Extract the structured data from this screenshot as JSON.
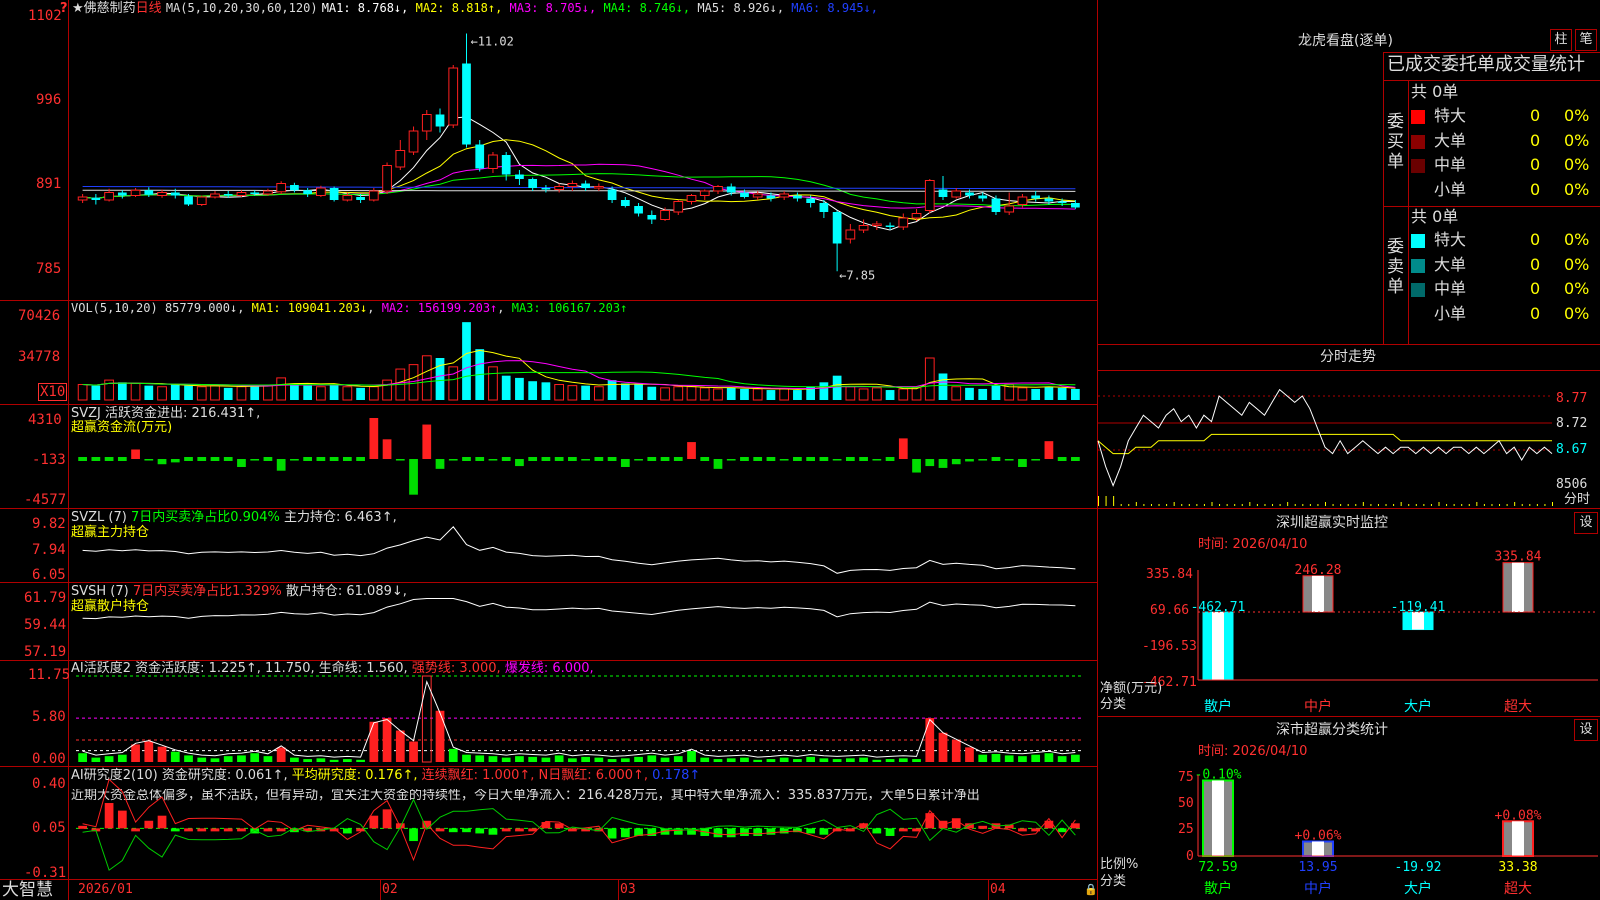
{
  "header": {
    "flag": "?",
    "star": "★",
    "stock_name": "佛慈制药",
    "period": "日线",
    "ma_params": "MA(5,10,20,30,60,120)",
    "ma_items": [
      {
        "label": "MA1: 8.768↓",
        "color": "#ffffff"
      },
      {
        "label": "MA2: 8.818↑",
        "color": "#ffff00"
      },
      {
        "label": "MA3: 8.705↓",
        "color": "#ff00ff"
      },
      {
        "label": "MA4: 8.746↓",
        "color": "#00ff00"
      },
      {
        "label": "MA5: 8.926↓",
        "color": "#dddddd"
      },
      {
        "label": "MA6: 8.945↓",
        "color": "#2040ff"
      }
    ]
  },
  "price_axis": [
    "1102",
    "996",
    "891",
    "785"
  ],
  "price_marks": {
    "high": "11.02",
    "low": "7.85"
  },
  "vol_header": {
    "params": "VOL(5,10,20)",
    "value": "85779.000↓",
    "ma1": "MA1: 109041.203↓",
    "ma2": "MA2: 156199.203↑",
    "ma3": "MA3: 106167.203↑"
  },
  "vol_axis": [
    "70426",
    "34778"
  ],
  "vol_unit": "X10",
  "svzj": {
    "title": "SVZJ  活跃资金进出: 216.431↑,",
    "sub": "超赢资金流(万元)",
    "axis": [
      "4310",
      "-133",
      "-4577"
    ]
  },
  "svzl": {
    "title": "SVZL (7)",
    "ratio": "7日内买卖净占比0.904%",
    "hold": "主力持仓: 6.463↑,",
    "sub": "超赢主力持仓",
    "axis": [
      "9.82",
      "7.94",
      "6.05"
    ]
  },
  "svsh": {
    "title": "SVSH (7)",
    "ratio": "7日内买卖净占比1.329%",
    "hold": "散户持仓: 61.089↓,",
    "sub": "超赢散户持仓",
    "axis": [
      "61.79",
      "59.44",
      "57.19"
    ]
  },
  "ai_active": {
    "title": "AI活跃度2",
    "t1": "资金活跃度: 1.225↑, 11.750,",
    "t2": "生命线: 1.560,",
    "t3": "强势线: 3.000,",
    "t4": "爆发线: 6.000,",
    "axis": [
      "11.75",
      "5.80",
      "0.00"
    ]
  },
  "ai_research": {
    "title": "AI研究度2(10)",
    "t1": "资金研究度: 0.061↑,",
    "t2": "平均研究度: 0.176↑,",
    "t3": "连续飘红: 1.000↑,",
    "t4": "N日飘红: 6.000↑,",
    "t5": "0.178↑",
    "comment": "近期大资金总体偏多，虽不活跃，但有异动，宜关注大资金的持续性，今日大单净流入：216.428万元，其中特大单净流入：335.837万元，大单5日累计净出",
    "axis": [
      "0.40",
      "0.05",
      "-0.31"
    ]
  },
  "date_axis": [
    "2026/01",
    "02",
    "03",
    "04"
  ],
  "brand": "大智慧",
  "right": {
    "lhkp_title": "龙虎看盘(逐单)",
    "btn_zhu": "柱",
    "btn_bi": "笔",
    "stats_title": "已成交委托单成交量统计",
    "buy_label": "委买单",
    "sell_label": "委卖单",
    "buy_total": "共 0单",
    "sell_total": "共 0单",
    "buy_rows": [
      {
        "name": "特大",
        "count": "0",
        "pct": "0%",
        "color": "#ff0000"
      },
      {
        "name": "大单",
        "count": "0",
        "pct": "0%",
        "color": "#8b0000"
      },
      {
        "name": "中单",
        "count": "0",
        "pct": "0%",
        "color": "#6a0000"
      },
      {
        "name": "小单",
        "count": "0",
        "pct": "0%",
        "color": "#000000"
      }
    ],
    "sell_rows": [
      {
        "name": "特大",
        "count": "0",
        "pct": "0%",
        "color": "#00ffff"
      },
      {
        "name": "大单",
        "count": "0",
        "pct": "0%",
        "color": "#008b8b"
      },
      {
        "name": "中单",
        "count": "0",
        "pct": "0%",
        "color": "#006a6a"
      },
      {
        "name": "小单",
        "count": "0",
        "pct": "0%",
        "color": "#000000"
      }
    ],
    "fs_title": "分时走势",
    "fs_axis": [
      "8.77",
      "8.72",
      "8.67",
      "8506",
      "分时"
    ],
    "monitor_title": "深圳超赢实时监控",
    "monitor_date": "时间: 2026/04/10",
    "monitor_btn": "设",
    "monitor_axis": [
      "335.84",
      "69.66",
      "-196.53",
      "-462.71"
    ],
    "monitor_ylabel": "净额(万元)",
    "monitor_xlabel": "分类",
    "monitor_bars": [
      {
        "cat": "散户",
        "value": -462.71,
        "label": "-462.71",
        "label_color": "#00ffff",
        "cat_color": "#00ffff"
      },
      {
        "cat": "中户",
        "value": 246.28,
        "label": "246.28",
        "label_color": "#ff3030",
        "cat_color": "#ff3030"
      },
      {
        "cat": "大户",
        "value": -119.41,
        "label": "-119.41",
        "label_color": "#00ffff",
        "cat_color": "#00ffff"
      },
      {
        "cat": "超大",
        "value": 335.84,
        "label": "335.84",
        "label_color": "#ff3030",
        "cat_color": "#ff3030"
      }
    ],
    "class_title": "深市超赢分类统计",
    "class_date": "时间: 2026/04/10",
    "class_btn": "设",
    "class_axis": [
      "75",
      "50",
      "25",
      "0"
    ],
    "class_ylabel": "比例%",
    "class_xlabel": "分类",
    "class_bars": [
      {
        "cat": "散户",
        "value": 72.59,
        "value_label": "72.59",
        "chg": "-0.10%",
        "chg_color": "#00ff00",
        "val_color": "#00ff00",
        "cat_color": "#00ff00",
        "bar": "#00ff00"
      },
      {
        "cat": "中户",
        "value": 13.95,
        "value_label": "13.95",
        "chg": "+0.06%",
        "chg_color": "#ff3030",
        "val_color": "#2040ff",
        "cat_color": "#2040ff",
        "bar": "#2040ff"
      },
      {
        "cat": "大户",
        "value": 0,
        "value_label": "-19.92",
        "chg": "",
        "chg_color": "#00ffff",
        "val_color": "#00ffff",
        "cat_color": "#00ffff",
        "bar": "#00ffff"
      },
      {
        "cat": "超大",
        "value": 33.38,
        "value_label": "33.38",
        "chg": "+0.08%",
        "chg_color": "#ff3030",
        "val_color": "#ffff00",
        "cat_color": "#ff3030",
        "bar": "#ff2020"
      }
    ]
  },
  "chart_data": {
    "type": "candlestick",
    "title": "佛慈制药 日线",
    "ylim": [
      7.6,
      11.2
    ],
    "candles": [
      [
        8.8,
        8.84,
        8.76,
        8.88
      ],
      [
        8.83,
        8.8,
        8.74,
        8.88
      ],
      [
        8.8,
        8.9,
        8.78,
        8.95
      ],
      [
        8.9,
        8.86,
        8.82,
        8.93
      ],
      [
        8.86,
        8.93,
        8.84,
        8.96
      ],
      [
        8.93,
        8.87,
        8.84,
        8.97
      ],
      [
        8.86,
        8.9,
        8.83,
        8.94
      ],
      [
        8.9,
        8.86,
        8.82,
        8.95
      ],
      [
        8.85,
        8.74,
        8.72,
        8.88
      ],
      [
        8.74,
        8.84,
        8.72,
        8.86
      ],
      [
        8.84,
        8.88,
        8.82,
        8.92
      ],
      [
        8.88,
        8.86,
        8.83,
        8.92
      ],
      [
        8.86,
        8.9,
        8.84,
        8.93
      ],
      [
        8.9,
        8.88,
        8.86,
        8.93
      ],
      [
        8.88,
        8.92,
        8.86,
        8.95
      ],
      [
        8.91,
        9.02,
        8.88,
        9.05
      ],
      [
        9.0,
        8.93,
        8.9,
        9.03
      ],
      [
        8.93,
        8.88,
        8.84,
        8.96
      ],
      [
        8.86,
        8.96,
        8.84,
        8.99
      ],
      [
        8.96,
        8.8,
        8.78,
        8.98
      ],
      [
        8.8,
        8.86,
        8.78,
        8.9
      ],
      [
        8.84,
        8.8,
        8.76,
        8.88
      ],
      [
        8.8,
        8.92,
        8.78,
        8.96
      ],
      [
        8.92,
        9.26,
        8.88,
        9.3
      ],
      [
        9.24,
        9.46,
        9.2,
        9.6
      ],
      [
        9.44,
        9.72,
        9.4,
        9.78
      ],
      [
        9.72,
        9.94,
        9.6,
        10.0
      ],
      [
        9.94,
        9.78,
        9.7,
        10.02
      ],
      [
        9.8,
        10.56,
        9.76,
        10.6
      ],
      [
        10.62,
        9.54,
        9.5,
        11.02
      ],
      [
        9.54,
        9.22,
        9.18,
        9.6
      ],
      [
        9.22,
        9.4,
        9.16,
        9.44
      ],
      [
        9.4,
        9.14,
        9.06,
        9.44
      ],
      [
        9.14,
        9.08,
        9.0,
        9.2
      ],
      [
        9.08,
        8.96,
        8.92,
        9.1
      ],
      [
        8.96,
        8.94,
        8.9,
        9.0
      ],
      [
        8.94,
        8.98,
        8.9,
        9.02
      ],
      [
        8.98,
        9.02,
        8.92,
        9.06
      ],
      [
        9.02,
        8.96,
        8.92,
        9.06
      ],
      [
        8.96,
        8.98,
        8.92,
        9.02
      ],
      [
        8.94,
        8.8,
        8.76,
        8.98
      ],
      [
        8.8,
        8.72,
        8.7,
        8.84
      ],
      [
        8.72,
        8.62,
        8.58,
        8.76
      ],
      [
        8.6,
        8.54,
        8.48,
        8.66
      ],
      [
        8.54,
        8.66,
        8.52,
        8.7
      ],
      [
        8.64,
        8.78,
        8.6,
        8.8
      ],
      [
        8.78,
        8.86,
        8.74,
        8.88
      ],
      [
        8.86,
        8.92,
        8.8,
        8.94
      ],
      [
        8.92,
        8.98,
        8.88,
        9.0
      ],
      [
        8.98,
        8.9,
        8.86,
        9.02
      ],
      [
        8.9,
        8.84,
        8.82,
        8.94
      ],
      [
        8.84,
        8.88,
        8.8,
        8.92
      ],
      [
        8.86,
        8.82,
        8.78,
        8.9
      ],
      [
        8.84,
        8.88,
        8.8,
        8.92
      ],
      [
        8.86,
        8.82,
        8.78,
        8.9
      ],
      [
        8.82,
        8.76,
        8.7,
        8.86
      ],
      [
        8.76,
        8.64,
        8.56,
        8.8
      ],
      [
        8.64,
        8.22,
        7.85,
        8.66
      ],
      [
        8.28,
        8.4,
        8.22,
        8.48
      ],
      [
        8.4,
        8.46,
        8.36,
        8.54
      ],
      [
        8.46,
        8.48,
        8.4,
        8.52
      ],
      [
        8.46,
        8.44,
        8.4,
        8.5
      ],
      [
        8.44,
        8.56,
        8.4,
        8.62
      ],
      [
        8.56,
        8.62,
        8.52,
        8.68
      ],
      [
        8.66,
        9.06,
        8.62,
        9.08
      ],
      [
        8.94,
        8.84,
        8.8,
        9.12
      ],
      [
        8.84,
        8.92,
        8.82,
        8.96
      ],
      [
        8.9,
        8.86,
        8.82,
        8.94
      ],
      [
        8.86,
        8.82,
        8.78,
        8.9
      ],
      [
        8.82,
        8.64,
        8.6,
        8.86
      ],
      [
        8.64,
        8.72,
        8.6,
        8.9
      ],
      [
        8.74,
        8.84,
        8.7,
        8.88
      ],
      [
        8.86,
        8.82,
        8.78,
        8.92
      ],
      [
        8.82,
        8.78,
        8.74,
        8.86
      ],
      [
        8.78,
        8.76,
        8.72,
        8.82
      ],
      [
        8.76,
        8.7,
        8.68,
        8.8
      ]
    ],
    "volume_ylim": [
      0,
      76000
    ],
    "volume": [
      14000,
      13000,
      18000,
      16000,
      15000,
      13000,
      12000,
      14000,
      13000,
      12000,
      13000,
      11000,
      12000,
      14000,
      13000,
      20000,
      15000,
      13000,
      12000,
      14000,
      12000,
      11000,
      12000,
      18000,
      28000,
      32000,
      40000,
      38000,
      30000,
      70426,
      46000,
      30000,
      22000,
      20000,
      17000,
      16000,
      14000,
      13000,
      13000,
      12000,
      18000,
      15000,
      14000,
      12000,
      11000,
      12000,
      12000,
      11000,
      10000,
      11000,
      10000,
      10000,
      9000,
      10000,
      9000,
      12000,
      16000,
      22000,
      12000,
      10000,
      11000,
      9000,
      10000,
      11000,
      38000,
      24000,
      12000,
      11000,
      10000,
      13000,
      14000,
      11000,
      10000,
      12000,
      11000,
      10000
    ],
    "fund_flow_ylim": [
      -4577,
      4310
    ],
    "fund_flow": [
      -133,
      -120,
      -140,
      -160,
      900,
      -300,
      -700,
      -500,
      -200,
      -100,
      -150,
      -200,
      -1000,
      -300,
      -200,
      -1400,
      -300,
      -200,
      -150,
      -100,
      -150,
      -200,
      4310,
      2000,
      -300,
      -4000,
      3600,
      -1200,
      -300,
      -250,
      -200,
      -300,
      -150,
      -900,
      -200,
      -150,
      -250,
      -200,
      -300,
      -150,
      -200,
      -1000,
      -300,
      -200,
      -150,
      -200,
      1700,
      -200,
      -1200,
      -300,
      -200,
      -150,
      -200,
      -300,
      -200,
      -150,
      -200,
      -300,
      -250,
      -200,
      -300,
      -200,
      2100,
      -1600,
      -900,
      -1100,
      -700,
      -400,
      -300,
      -200,
      -300,
      -1000,
      -300,
      1800,
      -250,
      -200
    ],
    "ai_active_ylim": [
      0,
      11.75
    ],
    "ai_active": [
      1.2,
      0.6,
      0.8,
      1.0,
      2.4,
      2.8,
      2.1,
      1.4,
      0.9,
      0.6,
      0.5,
      0.8,
      0.9,
      1.2,
      0.8,
      2.0,
      0.6,
      0.4,
      0.5,
      0.3,
      0.4,
      0.3,
      5.5,
      6.0,
      4.3,
      2.8,
      11.75,
      7.0,
      1.8,
      1.0,
      0.9,
      0.8,
      0.6,
      0.8,
      0.7,
      0.6,
      0.9,
      0.5,
      0.7,
      0.6,
      0.4,
      0.5,
      0.7,
      0.9,
      0.6,
      0.8,
      1.5,
      0.6,
      0.4,
      0.5,
      0.6,
      0.3,
      0.4,
      0.6,
      0.4,
      0.7,
      0.5,
      0.4,
      0.5,
      0.6,
      0.3,
      0.4,
      0.5,
      0.4,
      6.0,
      4.0,
      3.0,
      2.0,
      1.0,
      1.1,
      0.9,
      0.8,
      1.0,
      1.2,
      0.8,
      1.0
    ],
    "ai_research_ylim": [
      -0.31,
      0.4
    ],
    "ai_research": [
      0.02,
      0.0,
      0.2,
      0.14,
      0.0,
      0.06,
      0.1,
      -0.02,
      0.0,
      0.0,
      0.0,
      0.0,
      0.0,
      -0.04,
      0.0,
      0.0,
      -0.03,
      0.0,
      0.0,
      0.0,
      -0.04,
      0.0,
      0.1,
      0.15,
      0.04,
      -0.1,
      0.06,
      0.0,
      -0.03,
      -0.03,
      -0.04,
      -0.05,
      0.0,
      0.0,
      0.0,
      0.05,
      0.04,
      0.0,
      0.0,
      0.0,
      -0.08,
      -0.07,
      -0.06,
      -0.06,
      -0.05,
      -0.05,
      -0.05,
      -0.06,
      -0.07,
      -0.07,
      -0.06,
      -0.06,
      -0.05,
      -0.04,
      -0.03,
      -0.04,
      -0.05,
      0.0,
      0.0,
      0.04,
      -0.04,
      -0.06,
      0.0,
      0.0,
      0.12,
      0.06,
      0.08,
      0.04,
      0.02,
      0.04,
      0.03,
      0.0,
      0.0,
      0.06,
      -0.03,
      0.04
    ],
    "fs_ylim": [
      8.62,
      8.82
    ],
    "fs_price": [
      8.7,
      8.66,
      8.63,
      8.66,
      8.7,
      8.72,
      8.74,
      8.73,
      8.72,
      8.74,
      8.75,
      8.73,
      8.74,
      8.72,
      8.74,
      8.73,
      8.77,
      8.76,
      8.75,
      8.74,
      8.76,
      8.75,
      8.74,
      8.76,
      8.78,
      8.77,
      8.76,
      8.77,
      8.75,
      8.72,
      8.69,
      8.68,
      8.7,
      8.68,
      8.69,
      8.7,
      8.69,
      8.68,
      8.69,
      8.68,
      8.69,
      8.69,
      8.68,
      8.69,
      8.68,
      8.69,
      8.68,
      8.69,
      8.69,
      8.68,
      8.69,
      8.68,
      8.69,
      8.7,
      8.68,
      8.69,
      8.67,
      8.69,
      8.68,
      8.69,
      8.68
    ],
    "fs_avg": [
      8.7,
      8.69,
      8.68,
      8.68,
      8.68,
      8.69,
      8.69,
      8.69,
      8.7,
      8.7,
      8.7,
      8.7,
      8.7,
      8.7,
      8.7,
      8.71,
      8.71,
      8.71,
      8.71,
      8.71,
      8.71,
      8.71,
      8.71,
      8.71,
      8.71,
      8.71,
      8.71,
      8.71,
      8.71,
      8.71,
      8.71,
      8.71,
      8.71,
      8.71,
      8.71,
      8.71,
      8.71,
      8.71,
      8.71,
      8.71,
      8.7,
      8.7,
      8.7,
      8.7,
      8.7,
      8.7,
      8.7,
      8.7,
      8.7,
      8.7,
      8.7,
      8.7,
      8.7,
      8.7,
      8.7,
      8.7,
      8.7,
      8.7,
      8.7,
      8.7,
      8.7
    ]
  }
}
